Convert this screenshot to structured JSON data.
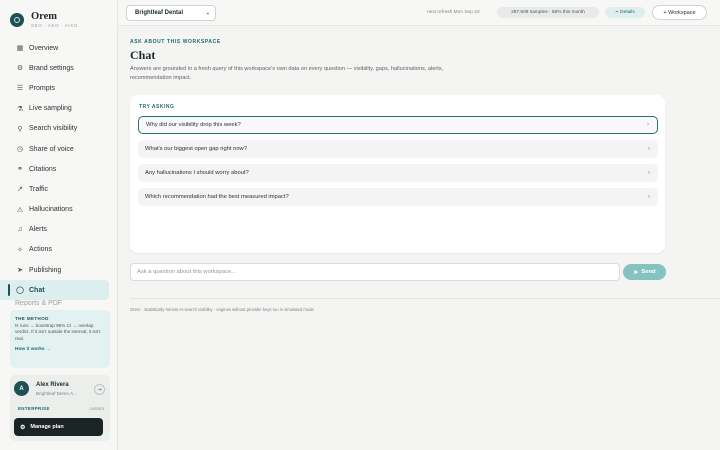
{
  "brand": {
    "name": "Orem",
    "tagline": "SEO · AEO · AIXO"
  },
  "nav": {
    "items": [
      {
        "label": "Overview",
        "icon": "grid-icon",
        "glyph": "▦"
      },
      {
        "label": "Brand settings",
        "icon": "settings-icon",
        "glyph": "⚙"
      },
      {
        "label": "Prompts",
        "icon": "list-icon",
        "glyph": "☰"
      },
      {
        "label": "Live sampling",
        "icon": "flask-icon",
        "glyph": "⚗"
      },
      {
        "label": "Search visibility",
        "icon": "search-icon",
        "glyph": "⚲"
      },
      {
        "label": "Share of voice",
        "icon": "clock-icon",
        "glyph": "◷"
      },
      {
        "label": "Citations",
        "icon": "link-icon",
        "glyph": "⚭"
      },
      {
        "label": "Traffic",
        "icon": "trend-icon",
        "glyph": "↗"
      },
      {
        "label": "Hallucinations",
        "icon": "warning-icon",
        "glyph": "⚠"
      },
      {
        "label": "Alerts",
        "icon": "bell-icon",
        "glyph": "♫"
      },
      {
        "label": "Actions",
        "icon": "lightbulb-icon",
        "glyph": "✧"
      },
      {
        "label": "Publishing",
        "icon": "send-icon",
        "glyph": "➤"
      },
      {
        "label": "Chat",
        "icon": "chat-icon",
        "glyph": "◯"
      }
    ],
    "active": "Chat",
    "cutoff_label": "Reports & PDF"
  },
  "method_card": {
    "title": "THE METHOD",
    "body": "N runs → bootstrap 95% CI → overlap verdict. If it isn't outside the interval, it isn't real.",
    "link": "How it works →"
  },
  "user": {
    "initial": "A",
    "name": "Alex Rivera",
    "org": "Brightleaf Demo A...",
    "tier": "ENTERPRISE",
    "plan_kind": "custom",
    "manage_label": "Manage plan"
  },
  "topbar": {
    "workspace": "Brightleaf Dental",
    "refresh": "next refresh Mon Sep 23",
    "samples": "287,509 samples · 58% this month",
    "details": "Details",
    "add_workspace": "+ Workspace"
  },
  "page": {
    "eyebrow": "ASK ABOUT THIS WORKSPACE",
    "title": "Chat",
    "description": "Answers are grounded in a fresh query of this workspace's own data on every question — visibility, gaps, hallucinations, alerts, recommendation impact."
  },
  "try_asking": {
    "label": "TRY ASKING",
    "suggestions": [
      "Why did our visibility drop this week?",
      "What's our biggest open gap right now?",
      "Any hallucinations I should worry about?",
      "Which recommendation had the best measured impact?"
    ]
  },
  "composer": {
    "placeholder": "Ask a question about this workspace...",
    "value": "",
    "send_label": "Send"
  },
  "footer": {
    "note": "Orem · statistically honest AI-search visibility · engines without provider keys run in simulated mode"
  },
  "colors": {
    "accent": "#1d4f55",
    "accent_light": "#dcefee",
    "send": "#86c3c0"
  }
}
